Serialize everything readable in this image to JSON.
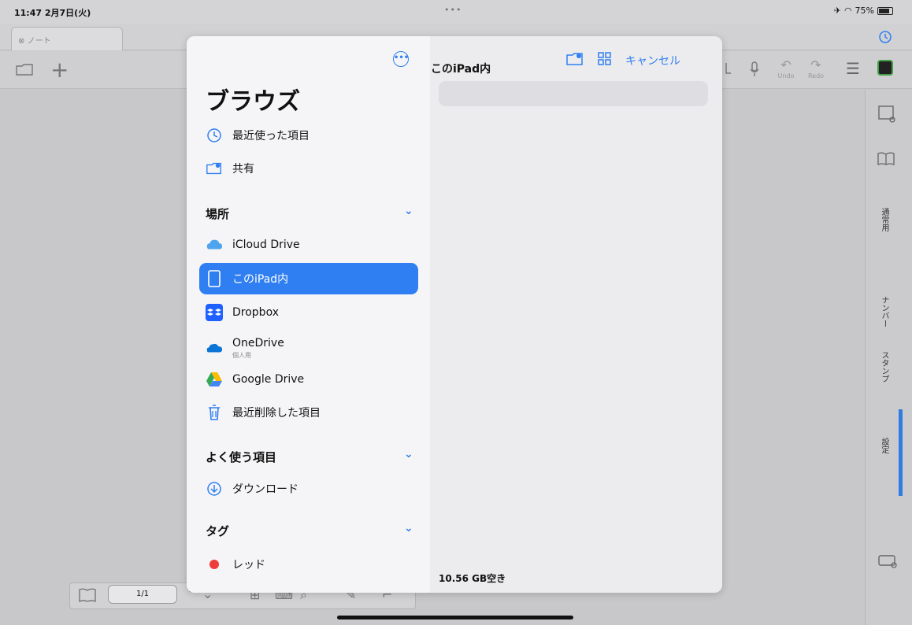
{
  "status": {
    "time": "11:47",
    "date": "2月7日(火)",
    "dots": "•••",
    "battery": "75%"
  },
  "app": {
    "tab_label": "ノート",
    "undo": "Undo",
    "redo": "Redo",
    "right_labels": [
      "通常用",
      "ナンバー",
      "スタンプ",
      "設定"
    ],
    "page_counter": "1/1"
  },
  "dialog": {
    "title": "ブラウズ",
    "current_location": "このiPad内",
    "cancel": "キャンセル",
    "storage_text": "10.56 GB空き",
    "quick_items": [
      {
        "label": "最近使った項目",
        "icon": "clock-icon"
      },
      {
        "label": "共有",
        "icon": "shared-folder-icon"
      }
    ],
    "sections": [
      {
        "title": "場所",
        "items": [
          {
            "label": "iCloud Drive",
            "icon": "icloud-icon"
          },
          {
            "label": "このiPad内",
            "icon": "ipad-icon",
            "selected": true
          },
          {
            "label": "Dropbox",
            "icon": "dropbox-icon"
          },
          {
            "label": "OneDrive",
            "sub": "個人用",
            "icon": "onedrive-icon"
          },
          {
            "label": "Google Drive",
            "icon": "google-drive-icon"
          },
          {
            "label": "最近削除した項目",
            "icon": "trash-icon"
          }
        ]
      },
      {
        "title": "よく使う項目",
        "items": [
          {
            "label": "ダウンロード",
            "icon": "download-icon"
          }
        ]
      },
      {
        "title": "タグ",
        "items": [
          {
            "label": "レッド",
            "icon": "red-tag-icon"
          }
        ]
      }
    ]
  },
  "colors": {
    "accent": "#2f7ff2",
    "selected_row": "#2f7ff2",
    "red_tag": "#f03b3b"
  }
}
